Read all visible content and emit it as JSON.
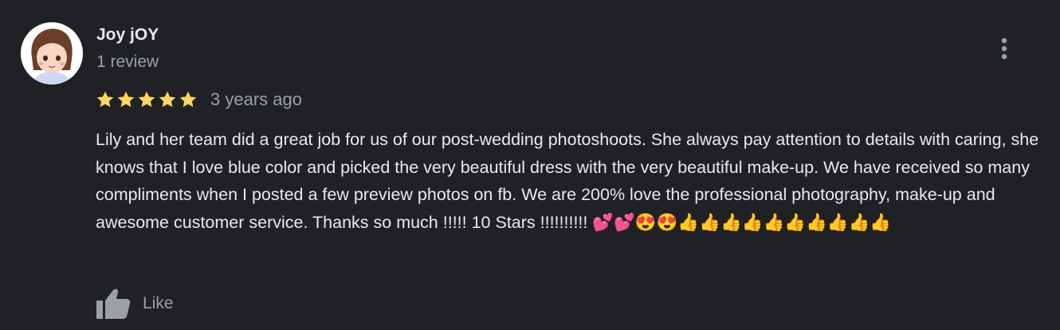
{
  "review": {
    "author_name": "Joy jOY",
    "review_count": "1 review",
    "rating": 5,
    "max_rating": 5,
    "date": "3 years ago",
    "text": "Lily and her team did a great job for us of our post-wedding photoshoots. She always pay attention to details with caring, she knows that I love blue color and picked the very beautiful dress with the very beautiful make-up. We have received so many compliments when I posted a few preview photos on fb. We are 200% love the professional photography, make-up and awesome customer service. Thanks so much !!!!! 10 Stars !!!!!!!!!! 💕💕😍😍👍👍👍👍👍👍👍👍👍👍",
    "like_label": "Like"
  },
  "icons": {
    "avatar": "cartoon-girl-avatar",
    "more": "vertical-dots-icon",
    "star": "star-icon",
    "like": "thumbs-up-icon"
  },
  "colors": {
    "background": "#202124",
    "text": "#e8eaed",
    "muted": "#9aa0a6",
    "star": "#fdd663"
  }
}
